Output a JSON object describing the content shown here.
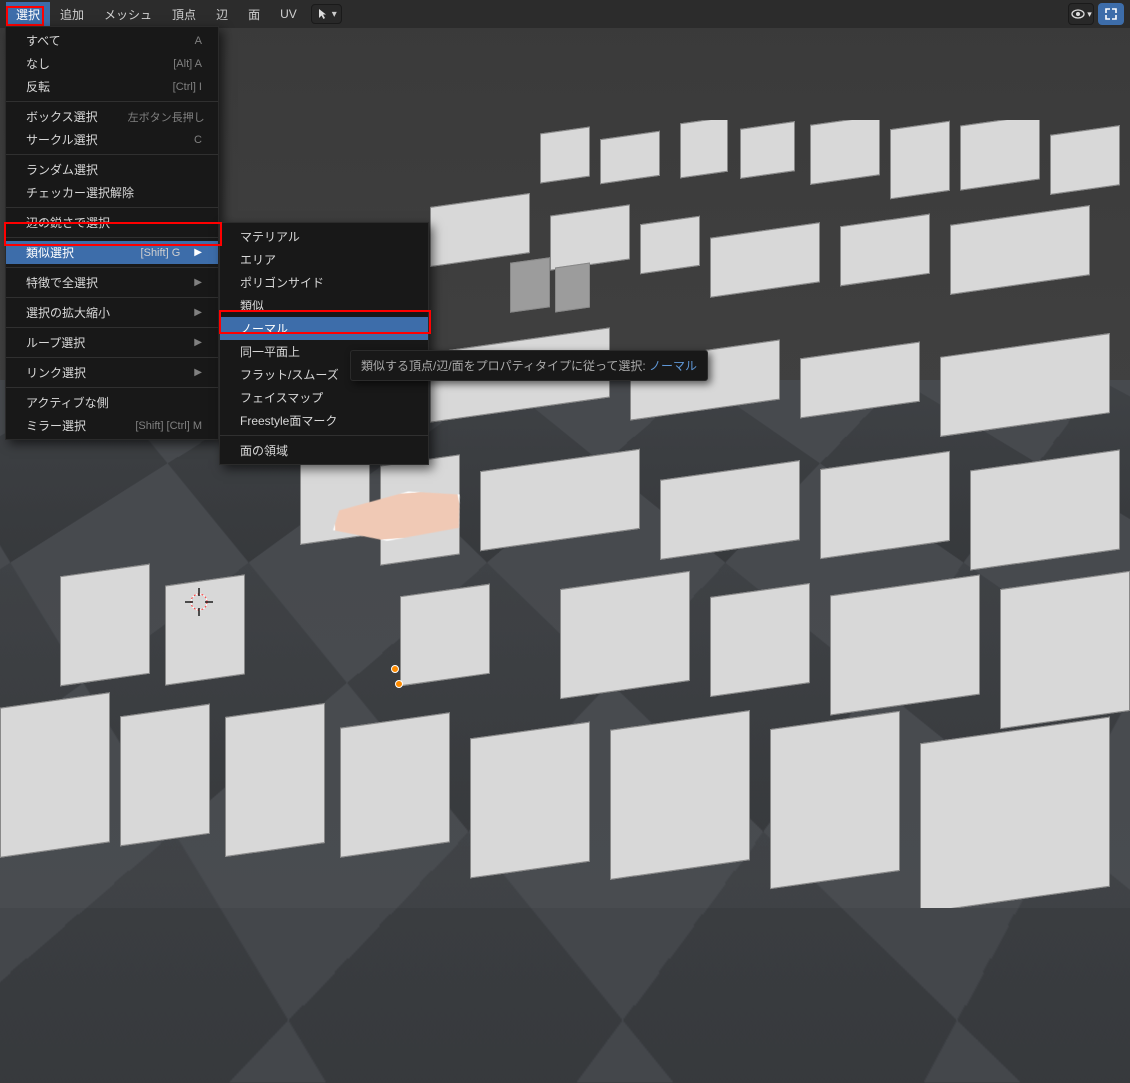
{
  "header": {
    "items": [
      {
        "label": "選択",
        "active": true
      },
      {
        "label": "追加"
      },
      {
        "label": "メッシュ"
      },
      {
        "label": "頂点"
      },
      {
        "label": "辺"
      },
      {
        "label": "面"
      },
      {
        "label": "UV"
      }
    ]
  },
  "main_menu": {
    "groups": [
      [
        {
          "label": "すべて",
          "shortcut": "A"
        },
        {
          "label": "なし",
          "shortcut": "[Alt] A"
        },
        {
          "label": "反転",
          "shortcut": "[Ctrl] I"
        }
      ],
      [
        {
          "label": "ボックス選択",
          "shortcut": "左ボタン長押し"
        },
        {
          "label": "サークル選択",
          "shortcut": "C"
        }
      ],
      [
        {
          "label": "ランダム選択"
        },
        {
          "label": "チェッカー選択解除"
        }
      ],
      [
        {
          "label": "辺の鋭さで選択"
        }
      ],
      [
        {
          "label": "類似選択",
          "shortcut": "[Shift] G",
          "submenu": true,
          "highlighted": true
        }
      ],
      [
        {
          "label": "特徴で全選択",
          "submenu": true
        }
      ],
      [
        {
          "label": "選択の拡大縮小",
          "submenu": true
        }
      ],
      [
        {
          "label": "ループ選択",
          "submenu": true
        }
      ],
      [
        {
          "label": "リンク選択",
          "submenu": true
        }
      ],
      [
        {
          "label": "アクティブな側"
        },
        {
          "label": "ミラー選択",
          "shortcut": "[Shift] [Ctrl] M"
        }
      ]
    ]
  },
  "sub_menu": {
    "groups": [
      [
        {
          "label": "マテリアル"
        },
        {
          "label": "エリア"
        },
        {
          "label": "ポリゴンサイド"
        },
        {
          "label": "類似"
        },
        {
          "label": "ノーマル",
          "highlighted": true
        },
        {
          "label": "同一平面上"
        },
        {
          "label": "フラット/スムーズ"
        },
        {
          "label": "フェイスマップ"
        },
        {
          "label": "Freestyle面マーク"
        }
      ],
      [
        {
          "label": "面の領域"
        }
      ]
    ]
  },
  "tooltip": {
    "text": "類似する頂点/辺/面をプロパティタイプに従って選択:",
    "accent": "ノーマル"
  }
}
